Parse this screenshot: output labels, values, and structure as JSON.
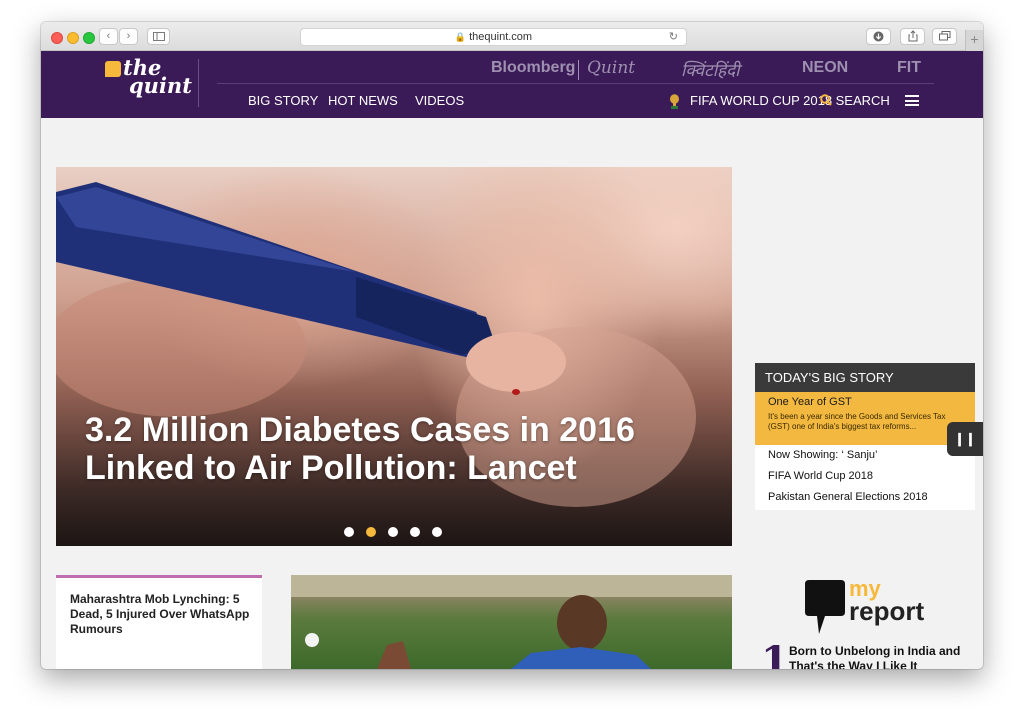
{
  "browser": {
    "url": "thequint.com",
    "new_tab_label": "+"
  },
  "nav": {
    "logo_line1": "the",
    "logo_line2": "quint",
    "partners": {
      "bloomberg": "Bloomberg",
      "quint": "Quint",
      "hindi": "क्विंटहिंदी",
      "neon": "NEON",
      "fit": "FIT"
    },
    "links": [
      "BIG STORY",
      "HOT NEWS",
      "VIDEOS"
    ],
    "fifa": "FIFA WORLD CUP 2018",
    "search": "SEARCH"
  },
  "hero": {
    "title": "3.2 Million Diabetes Cases in 2016 Linked to Air Pollution: Lancet",
    "slides": 5,
    "active_slide": 2
  },
  "big_story": {
    "heading": "TODAY'S BIG STORY",
    "active_title": "One Year of GST",
    "active_desc": "It's been a year since the Goods and Services Tax (GST) one of India's biggest tax reforms...",
    "items": [
      "Now Showing: ‘ Sanju’",
      "FIFA World Cup 2018",
      "Pakistan General Elections 2018"
    ]
  },
  "cards": {
    "card1_title": "Maharashtra Mob Lynching: 5 Dead, 5 Injured Over WhatsApp Rumours"
  },
  "my_report": {
    "my": "my",
    "report": "report",
    "rank": "1",
    "headline": "Born to Unbelong in India and That's the Way I Like It"
  },
  "colors": {
    "brand_purple": "#3b1b57",
    "accent_gold": "#f6b93b",
    "story_highlight": "#f2b83f"
  }
}
